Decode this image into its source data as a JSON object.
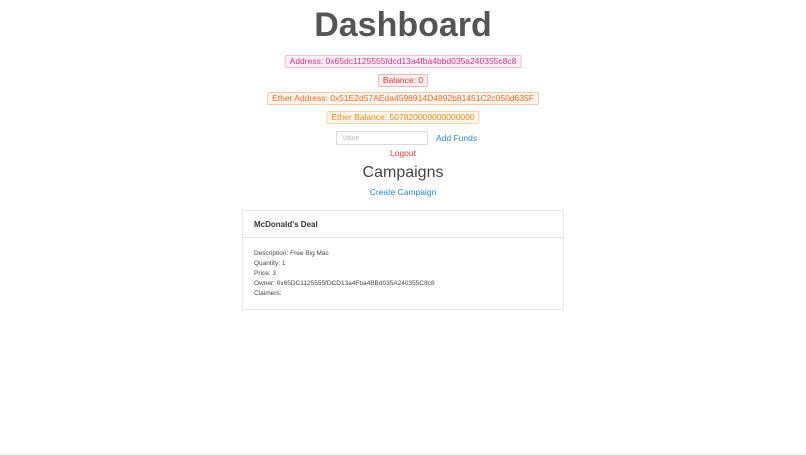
{
  "page": {
    "title": "Dashboard"
  },
  "account": {
    "address": "Address: 0x65dc1125555fdcd13a4fba4bbd035a240355c8c8",
    "balance": "Balance: 0",
    "ether_address": "Ether Address: 0x51E2d57AEda4598914D4892b81451C2c050d635F",
    "ether_balance": "Ether Balance: 507820000000000000"
  },
  "funds": {
    "placeholder": "Value",
    "add_label": "Add Funds"
  },
  "logout_label": "Logout",
  "campaigns": {
    "heading": "Campaigns",
    "create_label": "Create Campaign",
    "items": [
      {
        "title": "McDonald's Deal",
        "description": "Description: Free Big Mac",
        "quantity": "Quantity: 1",
        "price": "Price: 3",
        "owner": "Owner: 0x65DC1125555fDCD13a4Fba4BBd035A240355C8c8",
        "claimers": "Claimers:"
      }
    ]
  },
  "colors": {
    "title": "#555555",
    "link": "#2e86de",
    "logout": "#e03b3b",
    "badge_pink": "#d6338a",
    "badge_red": "#d23c3c",
    "badge_orange": "#e0722c",
    "badge_amber": "#ef8a1c"
  }
}
